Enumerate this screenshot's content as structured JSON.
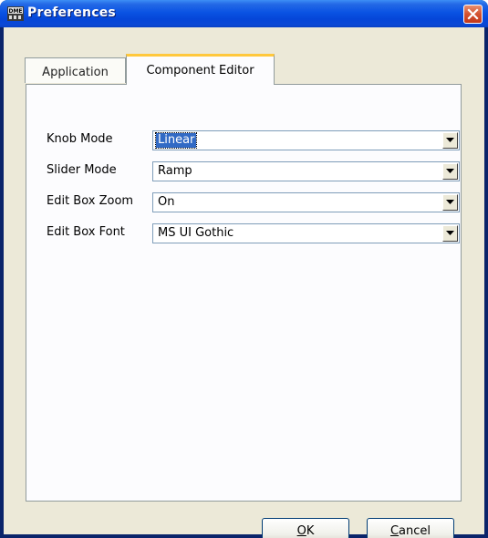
{
  "window": {
    "title": "Preferences",
    "icon": "dme-app-icon",
    "icon_text": "DME",
    "close_icon": "close-icon"
  },
  "tabs": [
    {
      "label": "Application",
      "active": false
    },
    {
      "label": "Component Editor",
      "active": true
    }
  ],
  "fields": [
    {
      "label": "Knob Mode",
      "value": "Linear",
      "focused": true
    },
    {
      "label": "Slider Mode",
      "value": "Ramp",
      "focused": false
    },
    {
      "label": "Edit Box Zoom",
      "value": "On",
      "focused": false
    },
    {
      "label": "Edit Box Font",
      "value": "MS UI Gothic",
      "focused": false
    }
  ],
  "buttons": {
    "ok": {
      "mnemonic": "O",
      "rest": "K"
    },
    "cancel": {
      "mnemonic": "C",
      "rest": "ancel"
    }
  },
  "colors": {
    "titlebar": "#0546d8",
    "close": "#d35230",
    "selection": "#316ac5",
    "active_tab_highlight": "#ffc83c"
  }
}
